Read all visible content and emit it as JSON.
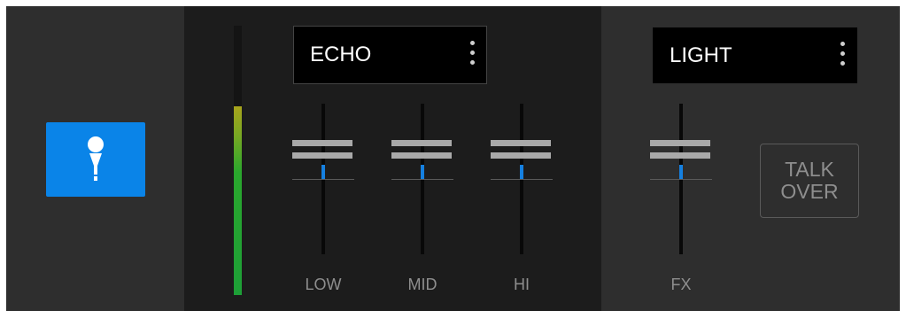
{
  "mic": {
    "label": "microphone",
    "icon": "microphone-icon",
    "color": "#0a84e8"
  },
  "meter": {
    "level_percent": 70
  },
  "effect": {
    "name": "ECHO"
  },
  "eq": [
    {
      "label": "LOW",
      "value_percent": 50
    },
    {
      "label": "MID",
      "value_percent": 50
    },
    {
      "label": "HI",
      "value_percent": 50
    }
  ],
  "fx": {
    "name": "LIGHT",
    "label": "FX",
    "value_percent": 50
  },
  "talkover": {
    "line1": "TALK",
    "line2": "OVER"
  }
}
